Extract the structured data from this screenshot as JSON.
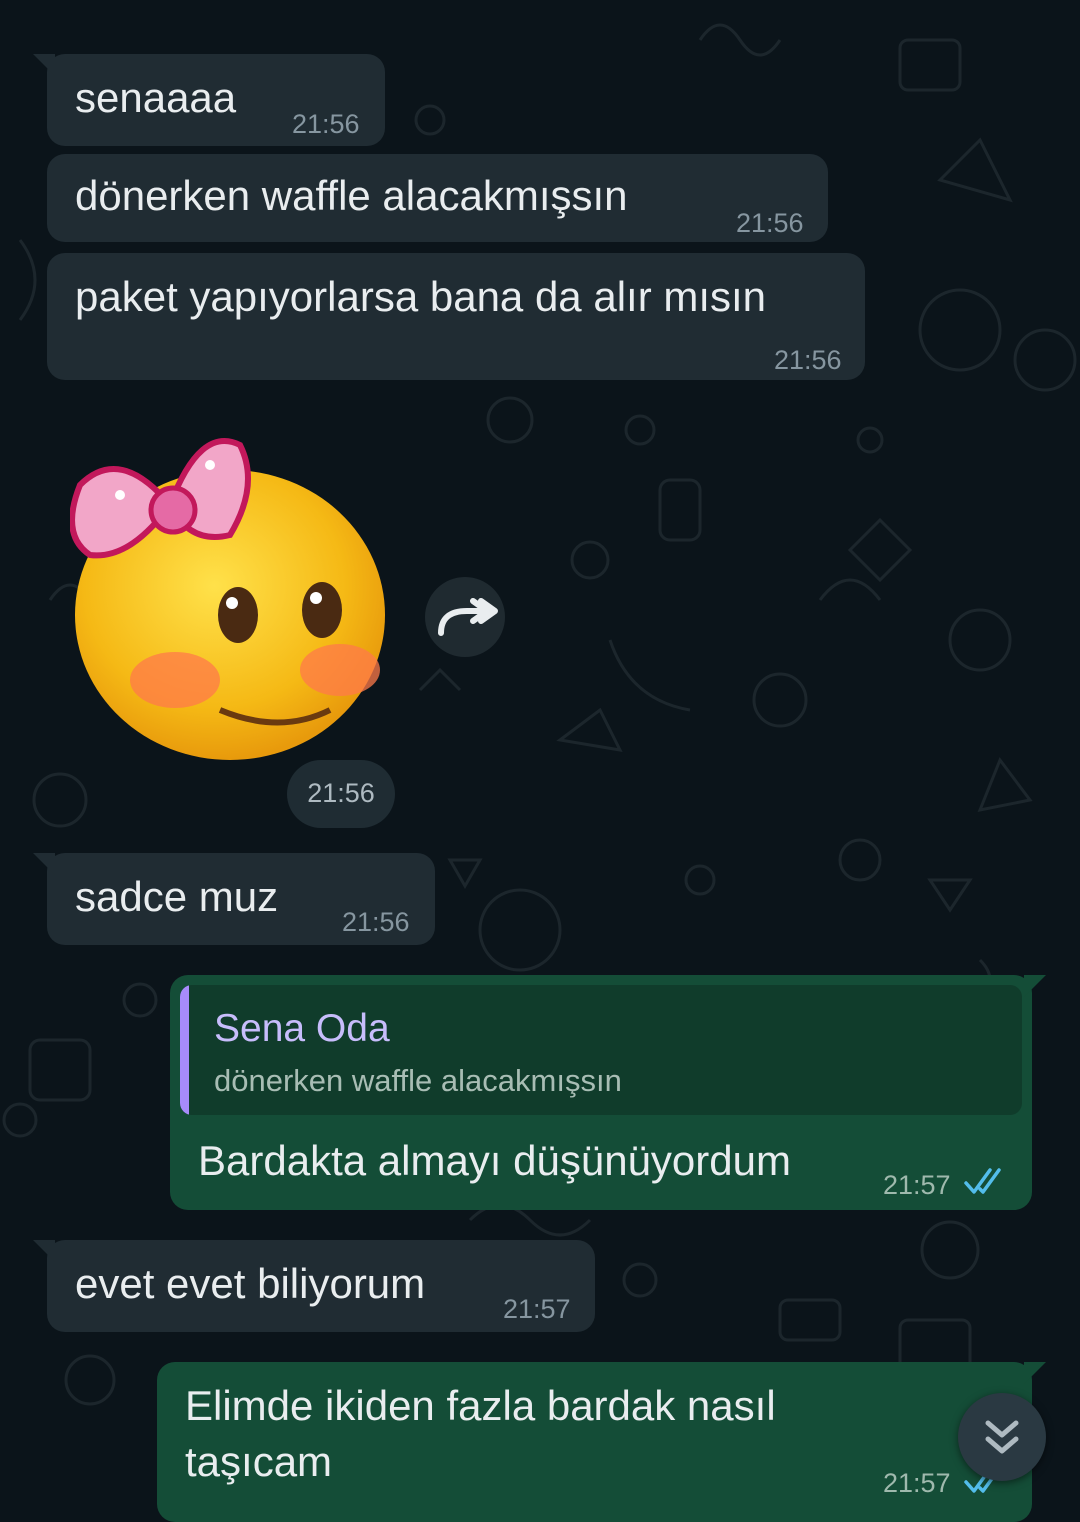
{
  "chat": {
    "contact_name": "Sena Oda",
    "messages": [
      {
        "direction": "incoming",
        "type": "text",
        "text": "senaaaa",
        "time": "21:56"
      },
      {
        "direction": "incoming",
        "type": "text",
        "text": "dönerken waffle alacakmışsın",
        "time": "21:56"
      },
      {
        "direction": "incoming",
        "type": "text",
        "text": "paket yapıyorlarsa bana da alır mısın",
        "time": "21:56"
      },
      {
        "direction": "incoming",
        "type": "sticker",
        "sticker": "smiling-face-with-bow-sticker",
        "time": "21:56"
      },
      {
        "direction": "incoming",
        "type": "text",
        "text": "sadce muz",
        "time": "21:56"
      },
      {
        "direction": "outgoing",
        "type": "reply",
        "quote_author": "Sena Oda",
        "quote_text": "dönerken waffle alacakmışsın",
        "text": "Bardakta almayı düşünüyordum",
        "time": "21:57",
        "status": "read"
      },
      {
        "direction": "incoming",
        "type": "text",
        "text": "evet evet biliyorum",
        "time": "21:57"
      },
      {
        "direction": "outgoing",
        "type": "text",
        "text_line1": "Elimde ikiden fazla bardak nasıl",
        "text_line2": "taşıcam",
        "time": "21:57",
        "status": "read"
      }
    ]
  },
  "icons": {
    "forward": "forward-icon",
    "read_receipt": "double-check-icon",
    "scroll_down": "double-chevron-down-icon"
  },
  "colors": {
    "background": "#0b141a",
    "incoming_bubble": "#202c33",
    "outgoing_bubble": "#144d37",
    "read_tick": "#53bdeb",
    "quote_bar": "#a78bfa"
  }
}
